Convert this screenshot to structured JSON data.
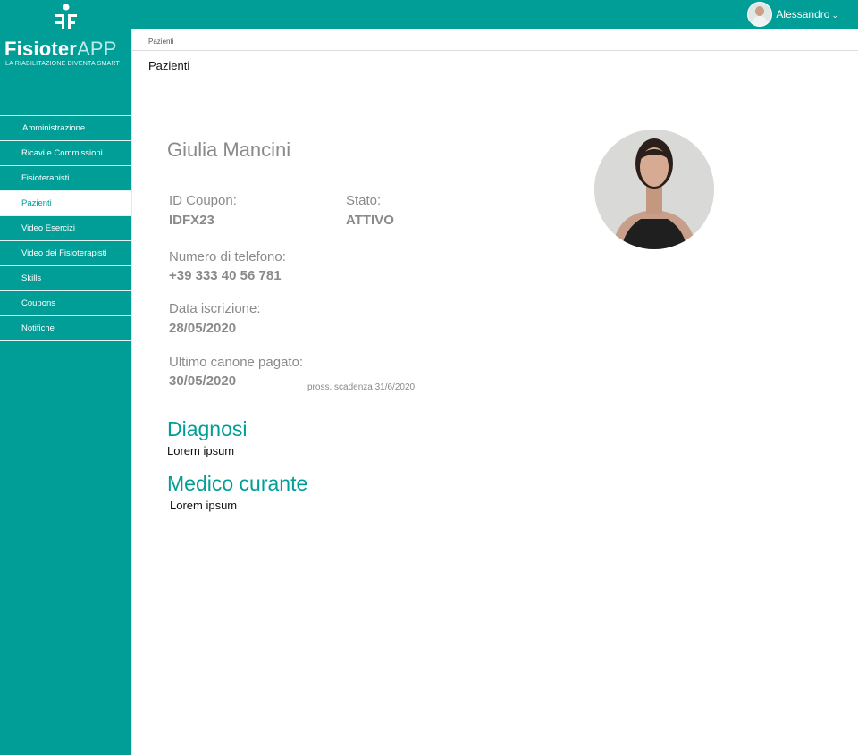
{
  "app": {
    "brand_name": "Fisioter",
    "brand_suffix": "APP",
    "tagline": "LA RIABILITAZIONE DIVENTA SMART",
    "user": {
      "name": "Alessandro",
      "menu_icon": "chevron-down-icon"
    }
  },
  "sidebar": {
    "items": [
      {
        "label": "Amministrazione"
      },
      {
        "label": "Ricavi e Commissioni"
      },
      {
        "label": "Fisioterapisti"
      },
      {
        "label": "Pazienti",
        "active": true
      },
      {
        "label": "Video Esercizi"
      },
      {
        "label": "Video dei Fisioterapisti"
      },
      {
        "label": "Skills"
      },
      {
        "label": "Coupons"
      },
      {
        "label": "Notifiche"
      }
    ]
  },
  "breadcrumb": {
    "current": "Pazienti"
  },
  "page": {
    "title": "Pazienti"
  },
  "patient": {
    "name": "Giulia Mancini",
    "coupon_label": "ID Coupon:",
    "coupon_value": "IDFX23",
    "status_label": "Stato:",
    "status_value": "ATTIVO",
    "phone_label": "Numero di telefono:",
    "phone_value": "+39 333 40 56 781",
    "signup_label": "Data iscrizione:",
    "signup_value": "28/05/2020",
    "last_fee_label": "Ultimo canone pagato:",
    "last_fee_value": "30/05/2020",
    "next_due_note": "pross. scadenza 31/6/2020",
    "diagnosis_title": "Diagnosi",
    "diagnosis_text": "Lorem ipsum",
    "doctor_title": "Medico curante",
    "doctor_text": "Lorem ipsum"
  },
  "colors": {
    "brand": "#009e97",
    "muted_text": "#8a8a8a"
  }
}
